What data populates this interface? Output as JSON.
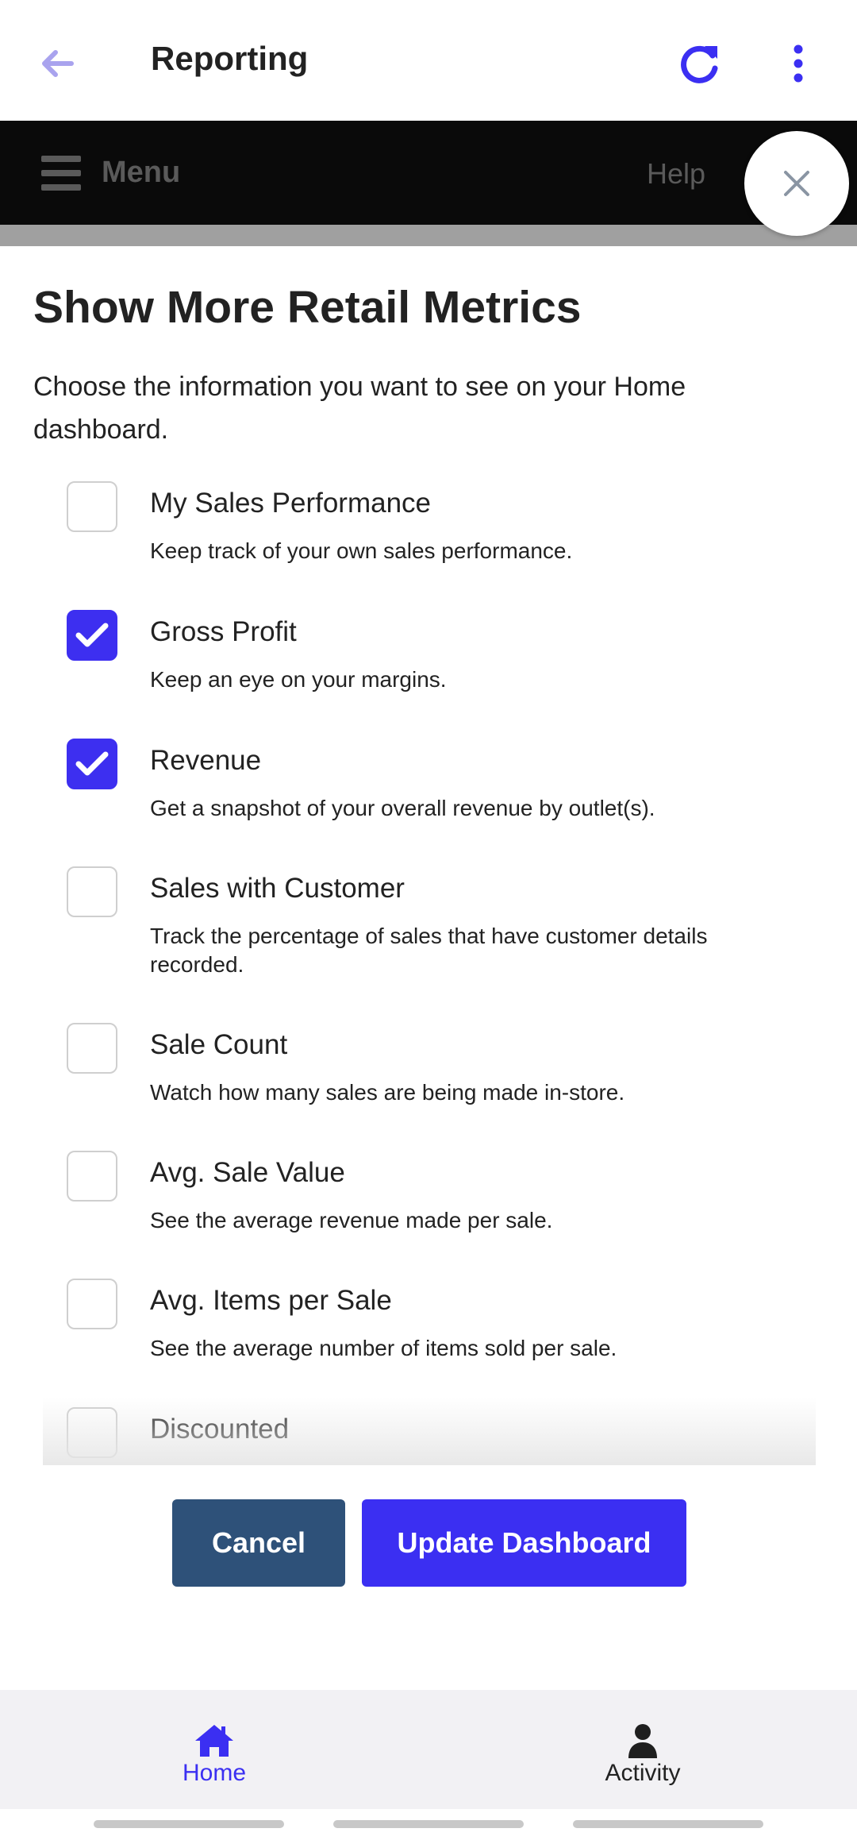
{
  "appbar": {
    "title": "Reporting",
    "back_icon": "arrow-left-icon",
    "refresh_icon": "refresh-icon",
    "more_icon": "more-vertical-icon"
  },
  "menubar": {
    "menu_label": "Menu",
    "help_label": "Help",
    "menu_icon": "hamburger-icon"
  },
  "modal": {
    "close_icon": "close-icon",
    "title": "Show More Retail Metrics",
    "intro": "Choose the information you want to see on your Home dashboard.",
    "options": [
      {
        "title": "My Sales Performance",
        "desc": "Keep track of your own sales performance.",
        "checked": false
      },
      {
        "title": "Gross Profit",
        "desc": "Keep an eye on your margins.",
        "checked": true
      },
      {
        "title": "Revenue",
        "desc": "Get a snapshot of your overall revenue by outlet(s).",
        "checked": true
      },
      {
        "title": "Sales with Customer",
        "desc": "Track the percentage of sales that have customer details recorded.",
        "checked": false
      },
      {
        "title": "Sale Count",
        "desc": "Watch how many sales are being made in-store.",
        "checked": false
      },
      {
        "title": "Avg. Sale Value",
        "desc": "See the average revenue made per sale.",
        "checked": false
      },
      {
        "title": "Avg. Items per Sale",
        "desc": "See the average number of items sold per sale.",
        "checked": false
      },
      {
        "title": "Discounted",
        "desc": "",
        "checked": false
      }
    ],
    "cancel_label": "Cancel",
    "update_label": "Update Dashboard"
  },
  "bottom_nav": {
    "items": [
      {
        "label": "Home",
        "icon": "home-icon",
        "active": true
      },
      {
        "label": "Activity",
        "icon": "person-icon",
        "active": false
      }
    ]
  },
  "colors": {
    "accent": "#3b2ff2",
    "cancel": "#2e5179",
    "menubar": "#0a0a0a"
  }
}
